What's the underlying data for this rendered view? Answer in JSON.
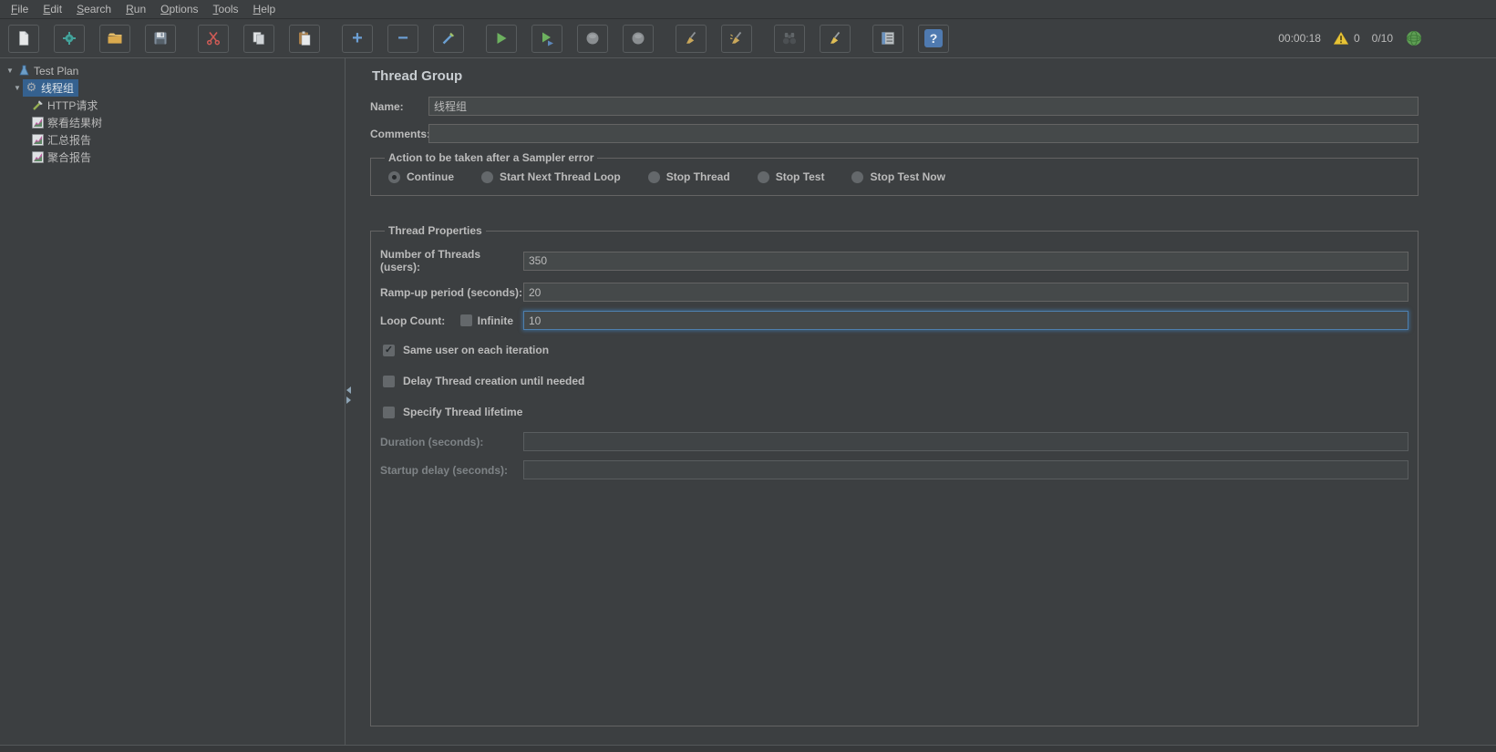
{
  "menu": {
    "items": [
      "File",
      "Edit",
      "Search",
      "Run",
      "Options",
      "Tools",
      "Help"
    ]
  },
  "toolbar": {
    "timer": "00:00:18",
    "warning_count": "0",
    "thread_counts": "0/10"
  },
  "tree": {
    "items": [
      {
        "label": "Test Plan"
      },
      {
        "label": "线程组"
      },
      {
        "label": "HTTP请求"
      },
      {
        "label": "察看结果树"
      },
      {
        "label": "汇总报告"
      },
      {
        "label": "聚合报告"
      }
    ]
  },
  "main": {
    "title": "Thread Group",
    "name_label": "Name:",
    "name_value": "线程组",
    "comments_label": "Comments:",
    "comments_value": "",
    "sampler_error": {
      "legend": "Action to be taken after a Sampler error",
      "options": [
        {
          "label": "Continue",
          "selected": true
        },
        {
          "label": "Start Next Thread Loop",
          "selected": false
        },
        {
          "label": "Stop Thread",
          "selected": false
        },
        {
          "label": "Stop Test",
          "selected": false
        },
        {
          "label": "Stop Test Now",
          "selected": false
        }
      ]
    },
    "thread_properties": {
      "legend": "Thread Properties",
      "num_threads_label": "Number of Threads (users):",
      "num_threads_value": "350",
      "rampup_label": "Ramp-up period (seconds):",
      "rampup_value": "20",
      "loop_label": "Loop Count:",
      "infinite_label": "Infinite",
      "infinite_checked": false,
      "loop_value": "10",
      "same_user_label": "Same user on each iteration",
      "same_user_checked": true,
      "delay_label": "Delay Thread creation until needed",
      "delay_checked": false,
      "lifetime_label": "Specify Thread lifetime",
      "lifetime_checked": false,
      "duration_label": "Duration (seconds):",
      "duration_value": "",
      "startup_label": "Startup delay (seconds):",
      "startup_value": ""
    }
  },
  "icons": {
    "tree_arrow": "▼",
    "gear": "⚙",
    "plus": "+",
    "minus": "−",
    "check": "✓",
    "help": "?"
  }
}
